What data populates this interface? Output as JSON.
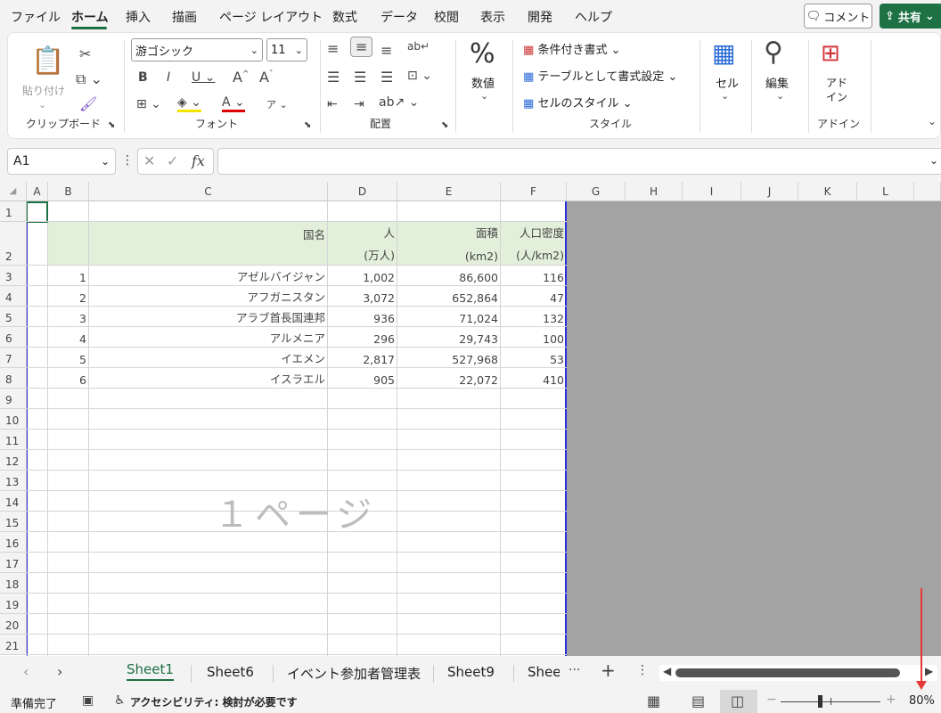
{
  "menu": {
    "items": [
      "ファイル",
      "ホーム",
      "挿入",
      "描画",
      "ページ レイアウト",
      "数式",
      "データ",
      "校閲",
      "表示",
      "開発",
      "ヘルプ"
    ],
    "comment": "コメント",
    "share": "共有"
  },
  "ribbon": {
    "clipboard": {
      "paste": "貼り付け",
      "label": "クリップボード"
    },
    "font": {
      "name": "游ゴシック",
      "size": "11",
      "label": "フォント"
    },
    "align": {
      "label": "配置"
    },
    "number": {
      "name": "数値"
    },
    "styles": {
      "cond": "条件付き書式",
      "table": "テーブルとして書式設定",
      "cell": "セルのスタイル",
      "label": "スタイル"
    },
    "cells": {
      "name": "セル"
    },
    "edit": {
      "name": "編集"
    },
    "addin": {
      "name": "アド\nイン",
      "label": "アドイン"
    }
  },
  "formula": {
    "namebox": "A1",
    "fx": "fx",
    "value": ""
  },
  "grid": {
    "columns": [
      "A",
      "B",
      "C",
      "D",
      "E",
      "F",
      "G",
      "H",
      "I",
      "J",
      "K",
      "L"
    ],
    "rows": [
      "1",
      "2",
      "3",
      "4",
      "5",
      "6",
      "7",
      "8",
      "9",
      "10",
      "11",
      "12",
      "13",
      "14",
      "15",
      "16",
      "17",
      "18",
      "19",
      "20",
      "21"
    ],
    "headers": {
      "country": "国名",
      "pop1": "人",
      "pop2": "(万人)",
      "area1": "面積",
      "area2": "(km2)",
      "dens1": "人口密度",
      "dens2": "(人/km2)"
    },
    "data": [
      [
        "1",
        "アゼルバイジャン",
        "1,002",
        "86,600",
        "116"
      ],
      [
        "2",
        "アフガニスタン",
        "3,072",
        "652,864",
        "47"
      ],
      [
        "3",
        "アラブ首長国連邦",
        "936",
        "71,024",
        "132"
      ],
      [
        "4",
        "アルメニア",
        "296",
        "29,743",
        "100"
      ],
      [
        "5",
        "イエメン",
        "2,817",
        "527,968",
        "53"
      ],
      [
        "6",
        "イスラエル",
        "905",
        "22,072",
        "410"
      ]
    ],
    "watermark": "１ページ"
  },
  "tabs": {
    "items": [
      "Sheet1",
      "Sheet6",
      "イベント参加者管理表",
      "Sheet9",
      "Shee"
    ]
  },
  "status": {
    "ready": "準備完了",
    "access": "アクセシビリティ: 検討が必要です",
    "zoom": "80%"
  }
}
